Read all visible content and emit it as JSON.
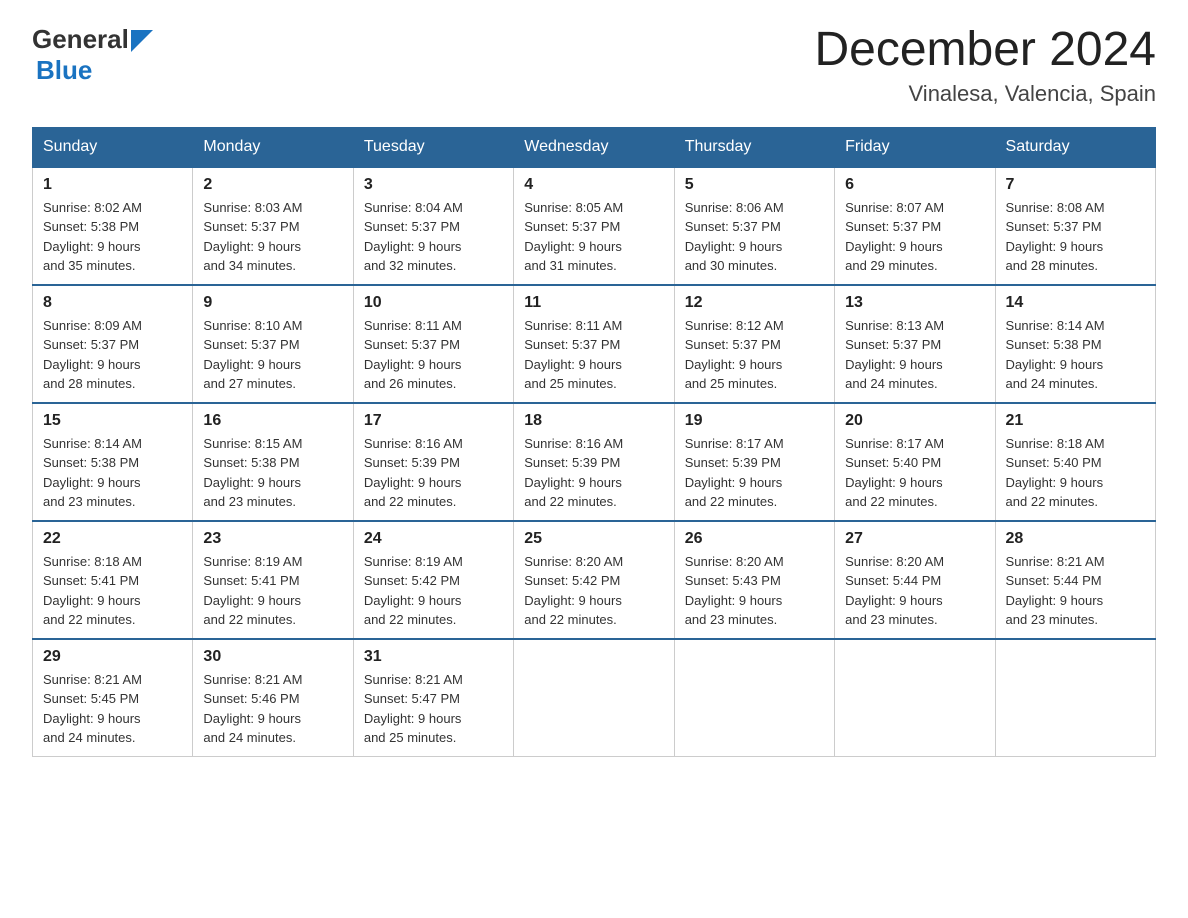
{
  "header": {
    "logo_general": "General",
    "logo_blue": "Blue",
    "month_title": "December 2024",
    "location": "Vinalesa, Valencia, Spain"
  },
  "days_of_week": [
    "Sunday",
    "Monday",
    "Tuesday",
    "Wednesday",
    "Thursday",
    "Friday",
    "Saturday"
  ],
  "weeks": [
    [
      {
        "day": "1",
        "sunrise": "8:02 AM",
        "sunset": "5:38 PM",
        "daylight": "9 hours and 35 minutes."
      },
      {
        "day": "2",
        "sunrise": "8:03 AM",
        "sunset": "5:37 PM",
        "daylight": "9 hours and 34 minutes."
      },
      {
        "day": "3",
        "sunrise": "8:04 AM",
        "sunset": "5:37 PM",
        "daylight": "9 hours and 32 minutes."
      },
      {
        "day": "4",
        "sunrise": "8:05 AM",
        "sunset": "5:37 PM",
        "daylight": "9 hours and 31 minutes."
      },
      {
        "day": "5",
        "sunrise": "8:06 AM",
        "sunset": "5:37 PM",
        "daylight": "9 hours and 30 minutes."
      },
      {
        "day": "6",
        "sunrise": "8:07 AM",
        "sunset": "5:37 PM",
        "daylight": "9 hours and 29 minutes."
      },
      {
        "day": "7",
        "sunrise": "8:08 AM",
        "sunset": "5:37 PM",
        "daylight": "9 hours and 28 minutes."
      }
    ],
    [
      {
        "day": "8",
        "sunrise": "8:09 AM",
        "sunset": "5:37 PM",
        "daylight": "9 hours and 28 minutes."
      },
      {
        "day": "9",
        "sunrise": "8:10 AM",
        "sunset": "5:37 PM",
        "daylight": "9 hours and 27 minutes."
      },
      {
        "day": "10",
        "sunrise": "8:11 AM",
        "sunset": "5:37 PM",
        "daylight": "9 hours and 26 minutes."
      },
      {
        "day": "11",
        "sunrise": "8:11 AM",
        "sunset": "5:37 PM",
        "daylight": "9 hours and 25 minutes."
      },
      {
        "day": "12",
        "sunrise": "8:12 AM",
        "sunset": "5:37 PM",
        "daylight": "9 hours and 25 minutes."
      },
      {
        "day": "13",
        "sunrise": "8:13 AM",
        "sunset": "5:37 PM",
        "daylight": "9 hours and 24 minutes."
      },
      {
        "day": "14",
        "sunrise": "8:14 AM",
        "sunset": "5:38 PM",
        "daylight": "9 hours and 24 minutes."
      }
    ],
    [
      {
        "day": "15",
        "sunrise": "8:14 AM",
        "sunset": "5:38 PM",
        "daylight": "9 hours and 23 minutes."
      },
      {
        "day": "16",
        "sunrise": "8:15 AM",
        "sunset": "5:38 PM",
        "daylight": "9 hours and 23 minutes."
      },
      {
        "day": "17",
        "sunrise": "8:16 AM",
        "sunset": "5:39 PM",
        "daylight": "9 hours and 22 minutes."
      },
      {
        "day": "18",
        "sunrise": "8:16 AM",
        "sunset": "5:39 PM",
        "daylight": "9 hours and 22 minutes."
      },
      {
        "day": "19",
        "sunrise": "8:17 AM",
        "sunset": "5:39 PM",
        "daylight": "9 hours and 22 minutes."
      },
      {
        "day": "20",
        "sunrise": "8:17 AM",
        "sunset": "5:40 PM",
        "daylight": "9 hours and 22 minutes."
      },
      {
        "day": "21",
        "sunrise": "8:18 AM",
        "sunset": "5:40 PM",
        "daylight": "9 hours and 22 minutes."
      }
    ],
    [
      {
        "day": "22",
        "sunrise": "8:18 AM",
        "sunset": "5:41 PM",
        "daylight": "9 hours and 22 minutes."
      },
      {
        "day": "23",
        "sunrise": "8:19 AM",
        "sunset": "5:41 PM",
        "daylight": "9 hours and 22 minutes."
      },
      {
        "day": "24",
        "sunrise": "8:19 AM",
        "sunset": "5:42 PM",
        "daylight": "9 hours and 22 minutes."
      },
      {
        "day": "25",
        "sunrise": "8:20 AM",
        "sunset": "5:42 PM",
        "daylight": "9 hours and 22 minutes."
      },
      {
        "day": "26",
        "sunrise": "8:20 AM",
        "sunset": "5:43 PM",
        "daylight": "9 hours and 23 minutes."
      },
      {
        "day": "27",
        "sunrise": "8:20 AM",
        "sunset": "5:44 PM",
        "daylight": "9 hours and 23 minutes."
      },
      {
        "day": "28",
        "sunrise": "8:21 AM",
        "sunset": "5:44 PM",
        "daylight": "9 hours and 23 minutes."
      }
    ],
    [
      {
        "day": "29",
        "sunrise": "8:21 AM",
        "sunset": "5:45 PM",
        "daylight": "9 hours and 24 minutes."
      },
      {
        "day": "30",
        "sunrise": "8:21 AM",
        "sunset": "5:46 PM",
        "daylight": "9 hours and 24 minutes."
      },
      {
        "day": "31",
        "sunrise": "8:21 AM",
        "sunset": "5:47 PM",
        "daylight": "9 hours and 25 minutes."
      },
      null,
      null,
      null,
      null
    ]
  ],
  "labels": {
    "sunrise": "Sunrise:",
    "sunset": "Sunset:",
    "daylight": "Daylight:"
  }
}
